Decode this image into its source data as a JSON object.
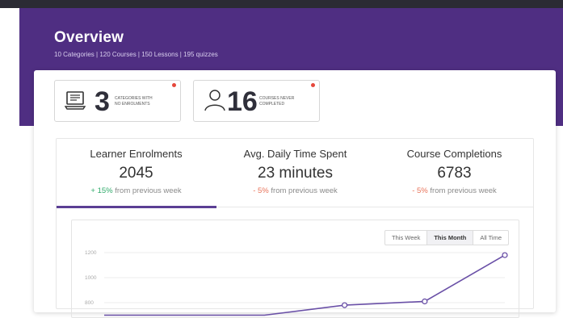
{
  "header": {
    "title": "Overview",
    "subtitle": "10 Categories | 120 Courses | 150 Lessons | 195 quizzes"
  },
  "stats": [
    {
      "value": "3",
      "label_line1": "CATEGORIES WITH",
      "label_line2": "NO ENROLMENTS",
      "icon": "computer-icon"
    },
    {
      "value": "16",
      "label_line1": "COURSES NEVER",
      "label_line2": "COMPLETED",
      "icon": "user-icon"
    }
  ],
  "tabs": [
    {
      "label": "Learner Enrolments",
      "value": "2045",
      "delta": "+ 15%",
      "delta_text": "from previous week",
      "trend": "up",
      "active": true
    },
    {
      "label": "Avg. Daily Time Spent",
      "value": "23 minutes",
      "delta": "- 5%",
      "delta_text": "from previous week",
      "trend": "down",
      "active": false
    },
    {
      "label": "Course Completions",
      "value": "6783",
      "delta": "- 5%",
      "delta_text": "from previous week",
      "trend": "down",
      "active": false
    }
  ],
  "range_buttons": [
    {
      "label": "This Week",
      "active": false
    },
    {
      "label": "This Month",
      "active": true
    },
    {
      "label": "All Time",
      "active": false
    }
  ],
  "chart_data": {
    "type": "line",
    "yticks": [
      "1200",
      "1000",
      "800"
    ],
    "points": [
      {
        "x": 0,
        "y": 700
      },
      {
        "x": 1,
        "y": 700
      },
      {
        "x": 2,
        "y": 700
      },
      {
        "x": 3,
        "y": 780
      },
      {
        "x": 4,
        "y": 810
      },
      {
        "x": 5,
        "y": 1180
      }
    ],
    "ylim": [
      700,
      1260
    ],
    "color": "#6a50a7"
  },
  "colors": {
    "brand": "#4f2e82",
    "accent": "#5b3f94",
    "up": "#2faa6a",
    "down": "#e8735a",
    "alert": "#e5473b"
  }
}
